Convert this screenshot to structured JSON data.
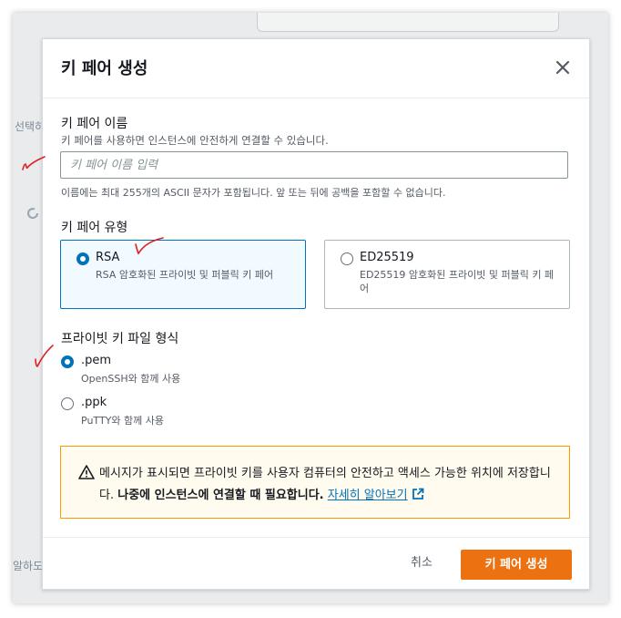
{
  "background": {
    "fragment_left_1": "선택하",
    "fragment_left_2": "알하도"
  },
  "modal": {
    "title": "키 페어 생성",
    "close_icon": "close-icon",
    "name_section": {
      "label": "키 페어 이름",
      "description": "키 페어를 사용하면 인스턴스에 안전하게 연결할 수 있습니다.",
      "placeholder": "키 페어 이름 입력",
      "value": "",
      "hint": "이름에는 최대 255개의 ASCII 문자가 포함됩니다. 앞 또는 뒤에 공백을 포함할 수 없습니다."
    },
    "type_section": {
      "label": "키 페어 유형",
      "options": [
        {
          "title": "RSA",
          "description": "RSA 암호화된 프라이빗 및 퍼블릭 키 페어",
          "selected": true
        },
        {
          "title": "ED25519",
          "description": "ED25519 암호화된 프라이빗 및 퍼블릭 키 페어",
          "selected": false
        }
      ]
    },
    "format_section": {
      "label": "프라이빗 키 파일 형식",
      "options": [
        {
          "label": ".pem",
          "description": "OpenSSH와 함께 사용",
          "selected": true
        },
        {
          "label": ".ppk",
          "description": "PuTTY와 함께 사용",
          "selected": false
        }
      ]
    },
    "alert": {
      "icon": "warning-icon",
      "text": "메시지가 표시되면 프라이빗 키를 사용자 컴퓨터의 안전하고 액세스 가능한 위치에 저장합니다. ",
      "bold_text": "나중에 인스턴스에 연결할 때 필요합니다.",
      "link_text": "자세히 알아보기",
      "link_icon": "external-link-icon"
    },
    "footer": {
      "cancel_label": "취소",
      "create_label": "키 페어 생성"
    }
  },
  "colors": {
    "accent": "#0073bb",
    "primary_button": "#ec7211",
    "alert_border": "#ff9900",
    "annotation_marks": "#e02020"
  }
}
